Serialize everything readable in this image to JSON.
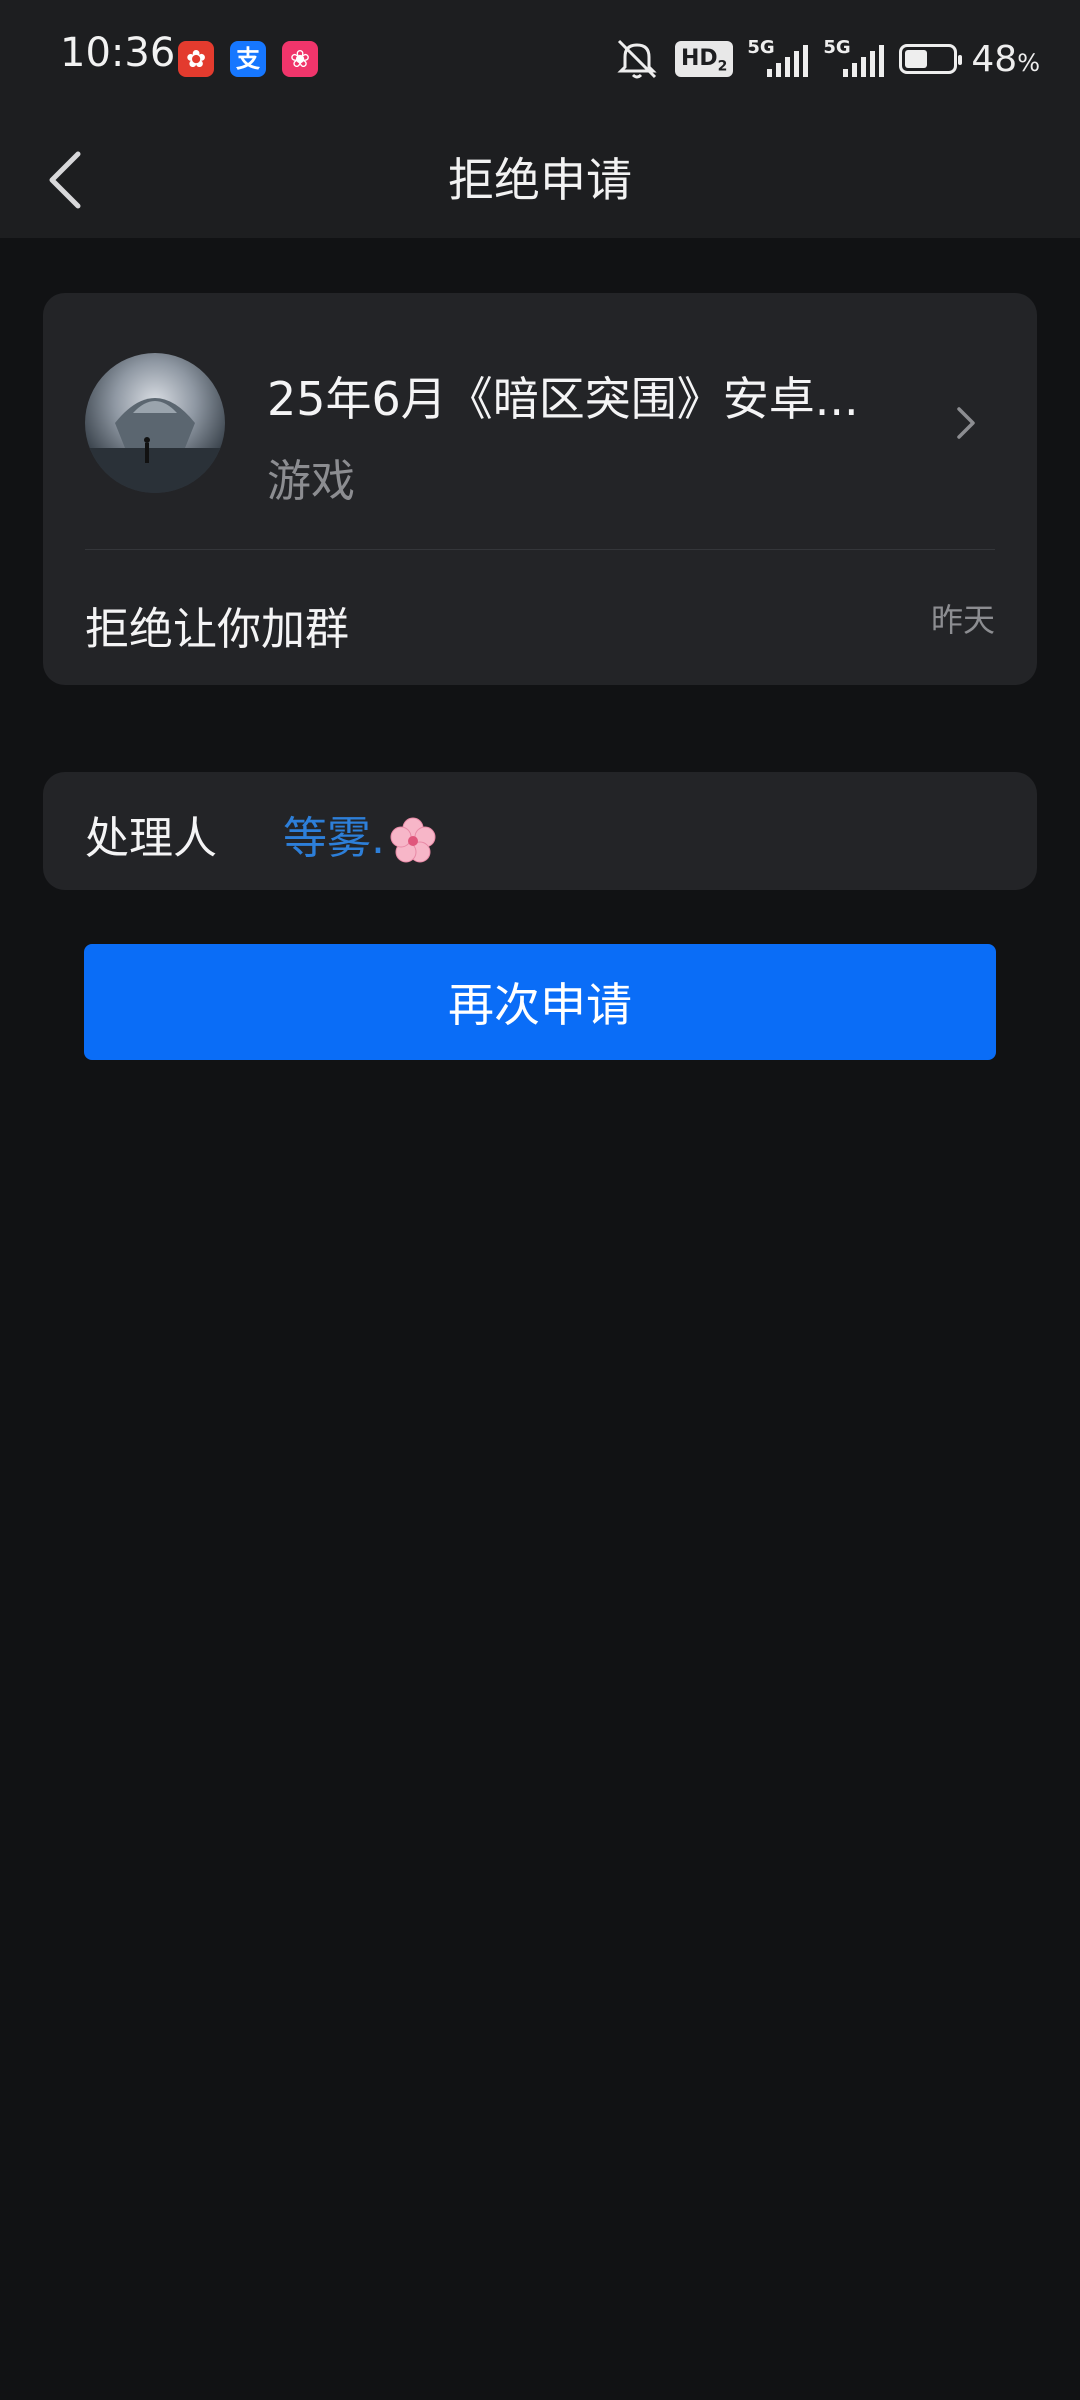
{
  "status_bar": {
    "time": "10:36",
    "network": "HD",
    "network_sub": "2",
    "sim1": "5G",
    "sim2": "5G",
    "battery_level": 0.48,
    "battery_percent": "48",
    "battery_unit": "%"
  },
  "header": {
    "title": "拒绝申请"
  },
  "group": {
    "name": "25年6月《暗区突围》安卓...",
    "type": "游戏",
    "message": "拒绝让你加群",
    "time": "昨天"
  },
  "handler": {
    "label": "处理人",
    "name": "等雾."
  },
  "actions": {
    "reapply_label": "再次申请"
  },
  "colors": {
    "background": "#111214",
    "card": "#232427",
    "accent": "#0a6df7",
    "link": "#2d7fd9"
  }
}
